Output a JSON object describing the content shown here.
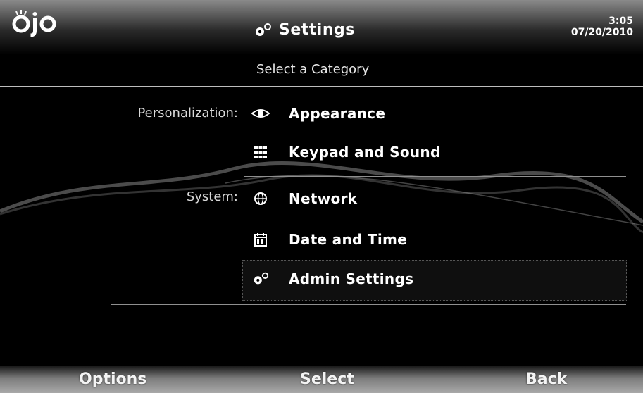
{
  "header": {
    "logo_text": "ojo",
    "title": "Settings",
    "time": "3:05",
    "date": "07/20/2010"
  },
  "subtitle": "Select a Category",
  "sections": {
    "personalization_label": "Personalization:",
    "system_label": "System:"
  },
  "items": [
    {
      "label": "Appearance",
      "icon": "eye-icon"
    },
    {
      "label": "Keypad and Sound",
      "icon": "keypad-icon"
    },
    {
      "label": "Network",
      "icon": "globe-icon"
    },
    {
      "label": "Date and Time",
      "icon": "calendar-icon"
    },
    {
      "label": "Admin Settings",
      "icon": "gears-icon"
    }
  ],
  "footer": {
    "left": "Options",
    "center": "Select",
    "right": "Back"
  }
}
